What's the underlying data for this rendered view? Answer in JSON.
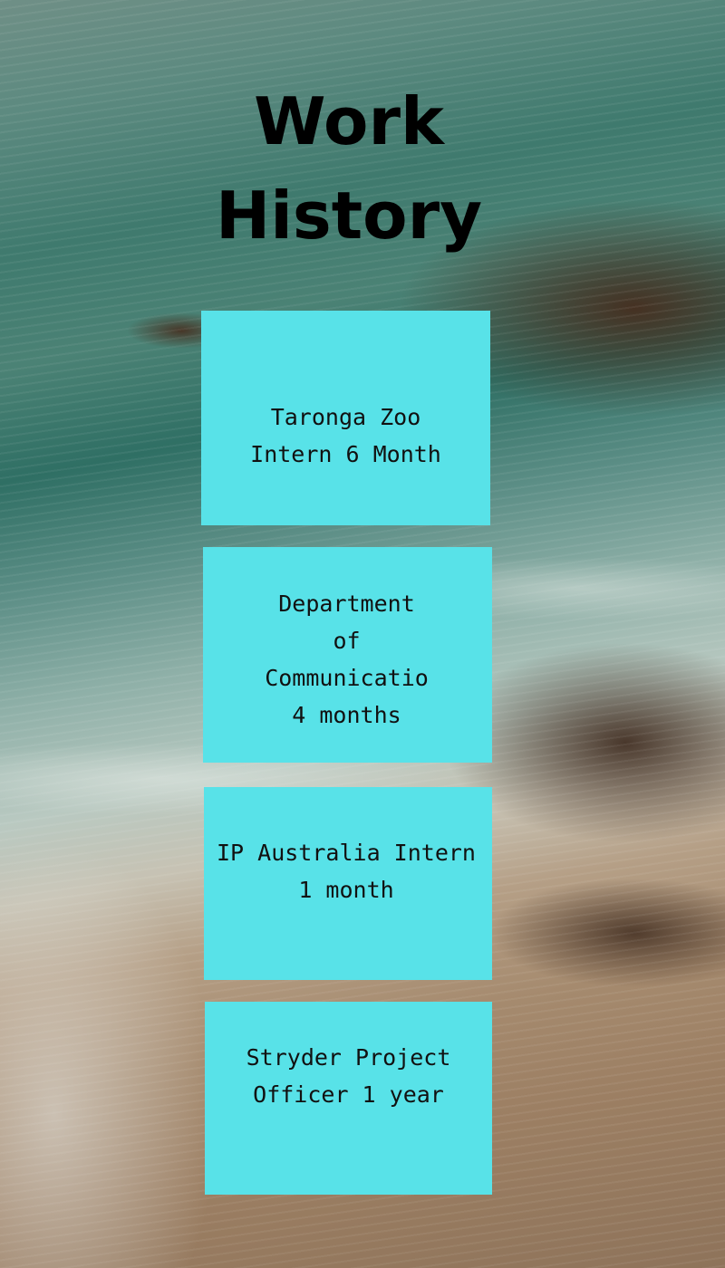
{
  "title": {
    "line1": "Work",
    "line2": "History"
  },
  "entries": [
    {
      "text": "Taronga Zoo\n  Intern 6 Month"
    },
    {
      "text": "Department\nof\nCommunicatio\n4 months"
    },
    {
      "text": "IP Australia Intern\n1 month"
    },
    {
      "text": "Stryder Project\nOfficer 1 year"
    }
  ],
  "colors": {
    "card_background": "#58e2e8",
    "title_text": "#000000"
  }
}
